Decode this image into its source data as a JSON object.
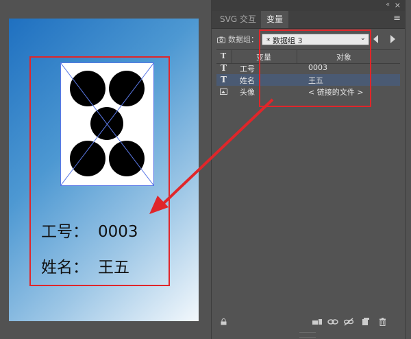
{
  "artboard": {
    "card": {
      "id_label": "工号：",
      "id_value": "0003",
      "name_label": "姓名：",
      "name_value": "王五"
    }
  },
  "panel": {
    "tabs": [
      {
        "label": "SVG 交互",
        "active": false
      },
      {
        "label": "变量",
        "active": true
      }
    ],
    "collapse_icon": "«",
    "close_icon": "×",
    "menu_icon": "≡",
    "dataset_label": "数据组：",
    "dataset_value": "* 数据组 3",
    "table": {
      "header_type": "T",
      "header_variable": "变量",
      "header_object": "对象",
      "rows": [
        {
          "type_icon": "T",
          "name": "工号",
          "object": "0003",
          "selected": false
        },
        {
          "type_icon": "T",
          "name": "姓名",
          "object": "王五",
          "selected": true
        },
        {
          "type_icon": "image-icon",
          "name": "头像",
          "object": "< 链接的文件 >",
          "selected": false
        }
      ]
    },
    "bottom_icons": [
      "lock-icon",
      "capture-dataset-icon",
      "bind-icon",
      "unbind-icon",
      "new-variable-icon",
      "trash-icon"
    ]
  },
  "colors": {
    "highlight_red": "#e0262a",
    "selected_row": "#4a5a73",
    "panel_bg": "#535353",
    "artboard_gradient_start": "#1f70c0",
    "artboard_gradient_end": "#f3f8fc"
  }
}
